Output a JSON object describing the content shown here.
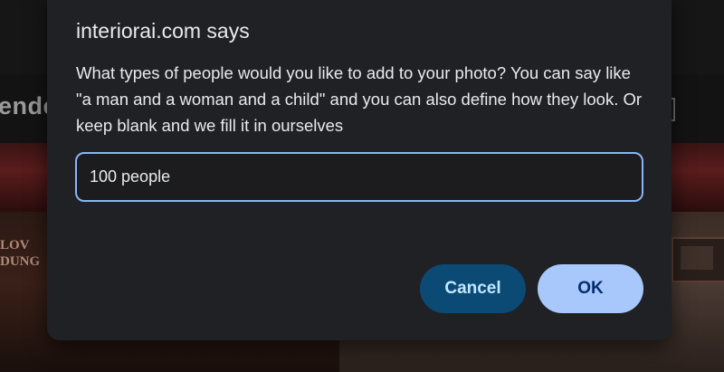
{
  "background": {
    "heading_fragment": "ende",
    "sign_text_line1": "LOV",
    "sign_text_line2": "DUNG"
  },
  "dialog": {
    "title": "interiorai.com says",
    "message": "What types of people would you like to add to your photo? You can say like \"a man and a woman and a child\" and you can also define how they look. Or keep blank and we fill it in ourselves",
    "input_value": "100 people",
    "cancel_label": "Cancel",
    "ok_label": "OK"
  },
  "colors": {
    "dialog_background": "#202124",
    "input_focus_border": "#8ab4f8",
    "cancel_button": "#0a4a75",
    "ok_button": "#a8c7fa"
  }
}
